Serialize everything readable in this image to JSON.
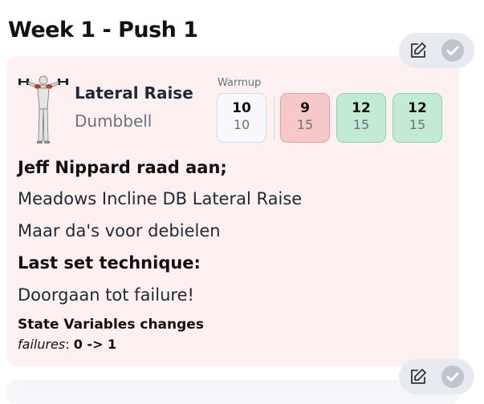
{
  "page": {
    "title": "Week 1 - Push 1"
  },
  "exercise": {
    "name": "Lateral Raise",
    "equipment": "Dumbbell",
    "warmup_label": "Warmup",
    "sets": [
      {
        "reps": "10",
        "target": "10",
        "state": "warmup"
      },
      {
        "reps": "9",
        "target": "15",
        "state": "failed"
      },
      {
        "reps": "12",
        "target": "15",
        "state": "done"
      },
      {
        "reps": "12",
        "target": "15",
        "state": "done"
      }
    ],
    "notes": {
      "heading1": "Jeff Nippard raad aan;",
      "line1": "Meadows Incline DB Lateral Raise",
      "line2": "Maar da's voor debielen",
      "heading2": "Last set technique:",
      "line3": "Doorgaan tot failure!"
    },
    "state_changes": {
      "title": "State Variables changes",
      "var_name": "failures",
      "separator": ": ",
      "change": "0 -> 1"
    }
  },
  "icons": {
    "edit": "edit-icon",
    "check": "check-icon"
  },
  "colors": {
    "card_bg": "#fdf0f1",
    "failed_set": "#f6c8c9",
    "done_set": "#c3ead3",
    "warmup_set": "#f6f8fb"
  }
}
